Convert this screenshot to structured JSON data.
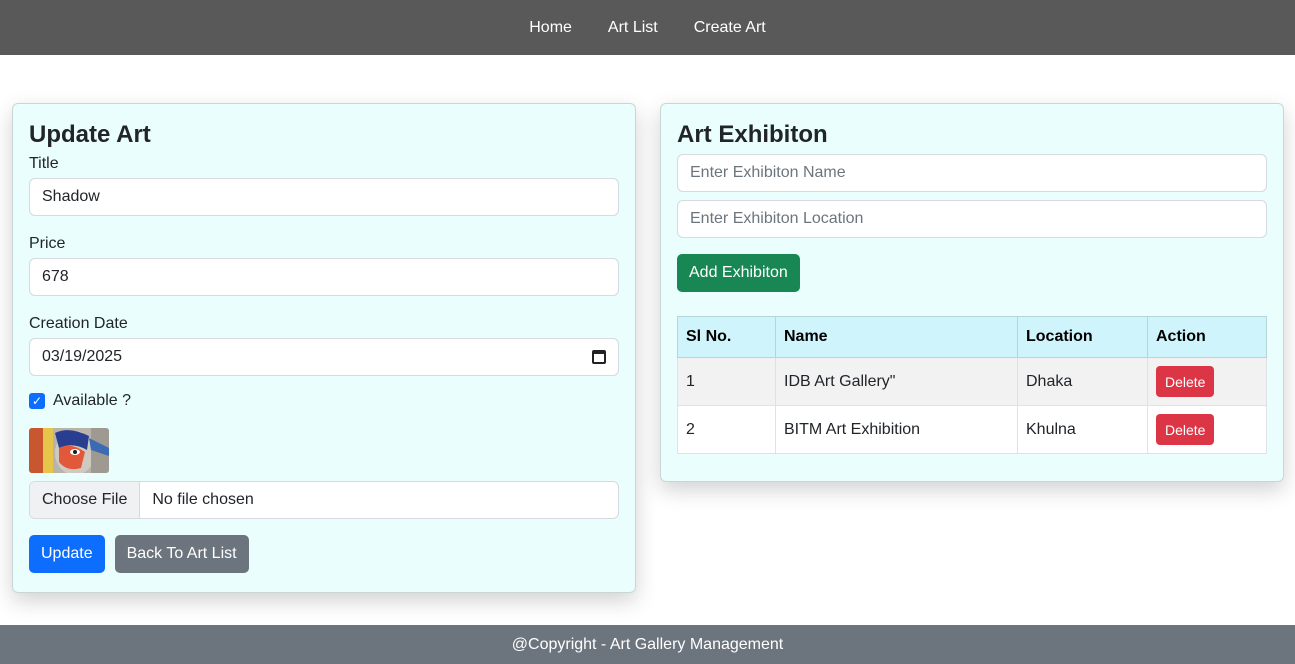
{
  "nav": {
    "items": [
      "Home",
      "Art List",
      "Create Art"
    ]
  },
  "update_form": {
    "title": "Update Art",
    "title_label": "Title",
    "title_value": "Shadow",
    "price_label": "Price",
    "price_value": "678",
    "date_label": "Creation Date",
    "date_value": "03/19/2025",
    "available_label": "Available ?",
    "available_checked": true,
    "file_button": "Choose File",
    "file_status": "No file chosen",
    "update_button": "Update",
    "back_button": "Back To Art List"
  },
  "exhibition": {
    "title": "Art Exhibiton",
    "name_placeholder": "Enter Exhibiton Name",
    "location_placeholder": "Enter Exhibiton Location",
    "add_button": "Add Exhibiton",
    "table": {
      "headers": [
        "Sl No.",
        "Name",
        "Location",
        "Action"
      ],
      "rows": [
        {
          "sl": "1",
          "name": "IDB Art Gallery\"",
          "location": "Dhaka",
          "action": "Delete"
        },
        {
          "sl": "2",
          "name": "BITM Art Exhibition",
          "location": "Khulna",
          "action": "Delete"
        }
      ]
    }
  },
  "footer": {
    "text": "@Copyright - Art Gallery Management"
  },
  "colors": {
    "navbar": "#595959",
    "card_bg": "#ebfefe",
    "primary": "#0d6efd",
    "success": "#198754",
    "danger": "#dc3545",
    "secondary": "#6c757d",
    "table_header": "#cff4fc"
  }
}
